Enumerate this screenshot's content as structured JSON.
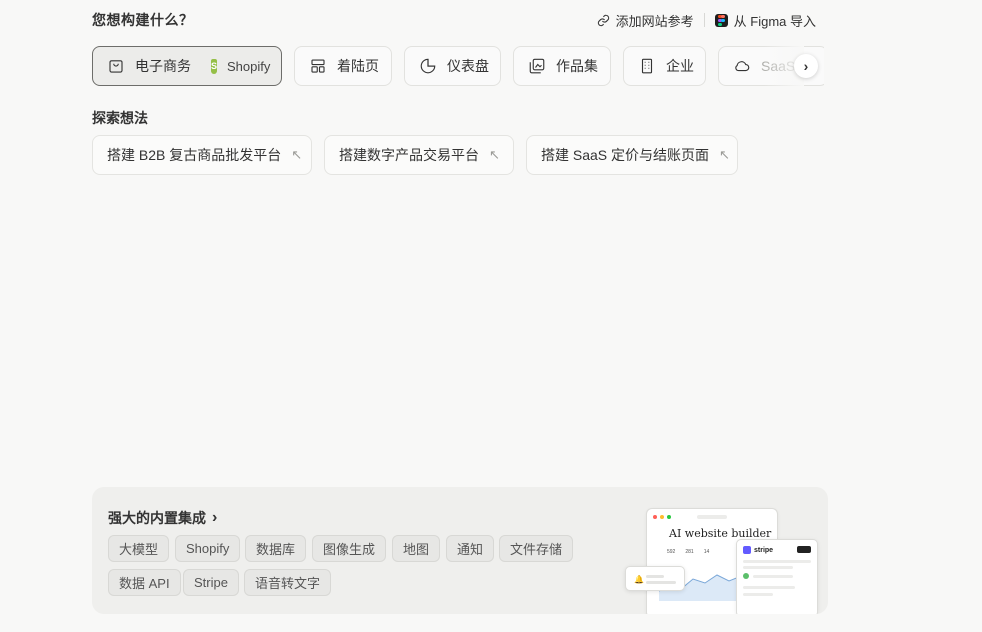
{
  "header": {
    "title": "您想构建什么？",
    "add_reference_label": "添加网站参考",
    "figma_import_label": "从 Figma 导入"
  },
  "categories": [
    {
      "label": "电子商务",
      "sub_label": "Shopify",
      "active": true,
      "icon": "shopping-bag-icon"
    },
    {
      "label": "着陆页",
      "icon": "layout-icon"
    },
    {
      "label": "仪表盘",
      "icon": "pie-chart-icon"
    },
    {
      "label": "作品集",
      "icon": "gallery-icon"
    },
    {
      "label": "企业",
      "icon": "building-icon"
    },
    {
      "label": "SaaS",
      "icon": "cloud-icon"
    }
  ],
  "ideas": {
    "title": "探索想法",
    "items": [
      "搭建 B2B 复古商品批发平台",
      "搭建数字产品交易平台",
      "搭建 SaaS 定价与结账页面"
    ]
  },
  "integrations": {
    "title": "强大的内置集成",
    "tags": [
      "大模型",
      "Shopify",
      "数据库",
      "图像生成",
      "地图",
      "通知",
      "文件存储",
      "数据 API",
      "Stripe",
      "语音转文字"
    ],
    "preview": {
      "heading": "AI website builder",
      "stats": [
        "592",
        "281",
        "14"
      ],
      "stripe_label": "stripe"
    }
  },
  "colors": {
    "background": "#f8f8f7",
    "shopify_green": "#95bf47",
    "stripe_purple": "#635bff"
  }
}
